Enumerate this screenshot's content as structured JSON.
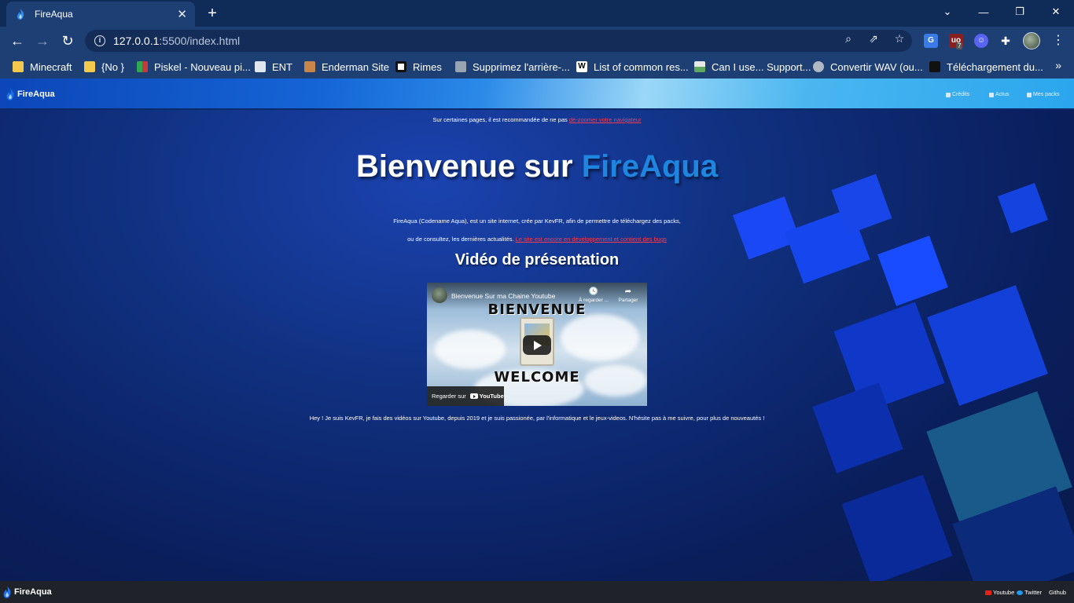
{
  "tab": {
    "title": "FireAqua",
    "close": "✕"
  },
  "newtab": "+",
  "window_controls": {
    "minimize": "—",
    "restore": "❐",
    "close": "✕",
    "tabsearch": "⌄"
  },
  "address": {
    "host": "127.0.0.1",
    "path": ":5500/index.html"
  },
  "extensions": {
    "ublock_badge": "7"
  },
  "bookmarks": [
    {
      "label": "Minecraft",
      "color": "#f2c94c"
    },
    {
      "label": "{No }",
      "color": "#f2c94c"
    },
    {
      "label": "Piskel - Nouveau pi...",
      "color": "#2fa84f"
    },
    {
      "label": "ENT",
      "color": "#dfe6f0"
    },
    {
      "label": "Enderman Site",
      "color": "#c9864b"
    },
    {
      "label": "Rimes",
      "color": "#111111"
    },
    {
      "label": "Supprimez l'arrière-...",
      "color": "#9aa4b0"
    },
    {
      "label": "List of common res...",
      "color": "#ffffff"
    },
    {
      "label": "Can I use... Support...",
      "color": "#5fa85f"
    },
    {
      "label": "Convertir WAV (ou...",
      "color": "#b0b8c4"
    },
    {
      "label": "Téléchargement du...",
      "color": "#111111"
    }
  ],
  "bookmarks_more": "»",
  "site": {
    "logo": "FireAqua",
    "nav": [
      "Crédits",
      "Actus",
      "Mes packs"
    ],
    "notice_text": "Sur certaines pages, il est recommandée de ne pas ",
    "notice_link": "dé-zoomer votre navigateur",
    "welcome_prefix": "Bienvenue sur ",
    "welcome_brand": "FireAqua",
    "desc_line1": "FireAqua (Codename Aqua), est un site internet, crée par KevFR, afin de permettre de téléchargez des packs,",
    "desc_line2": "ou de consultez, les dernières actualités. ",
    "desc_link": "Le site est encore en développement et contient des bugs",
    "video_title": "Vidéo de présentation",
    "video": {
      "channel": "Bienvenue Sur ma Chaine Youtube",
      "watch_later": "À regarder ...",
      "share": "Partager",
      "text_top": "BIENVENUE",
      "text_bottom": "WELCOME",
      "watch_on": "Regarder sur",
      "youtube": "YouTube"
    },
    "bio": "Hey ! Je suis KevFR, je fais des vidéos sur Youtube, depuis 2019 et je suis passionée, par l'informatique et le jeux-videos. N'hésite pas à me suivre, pour plus de nouveautés !",
    "footer_logo": "FireAqua",
    "footer_links": [
      "Youtube",
      "Twitter",
      "Github"
    ]
  }
}
